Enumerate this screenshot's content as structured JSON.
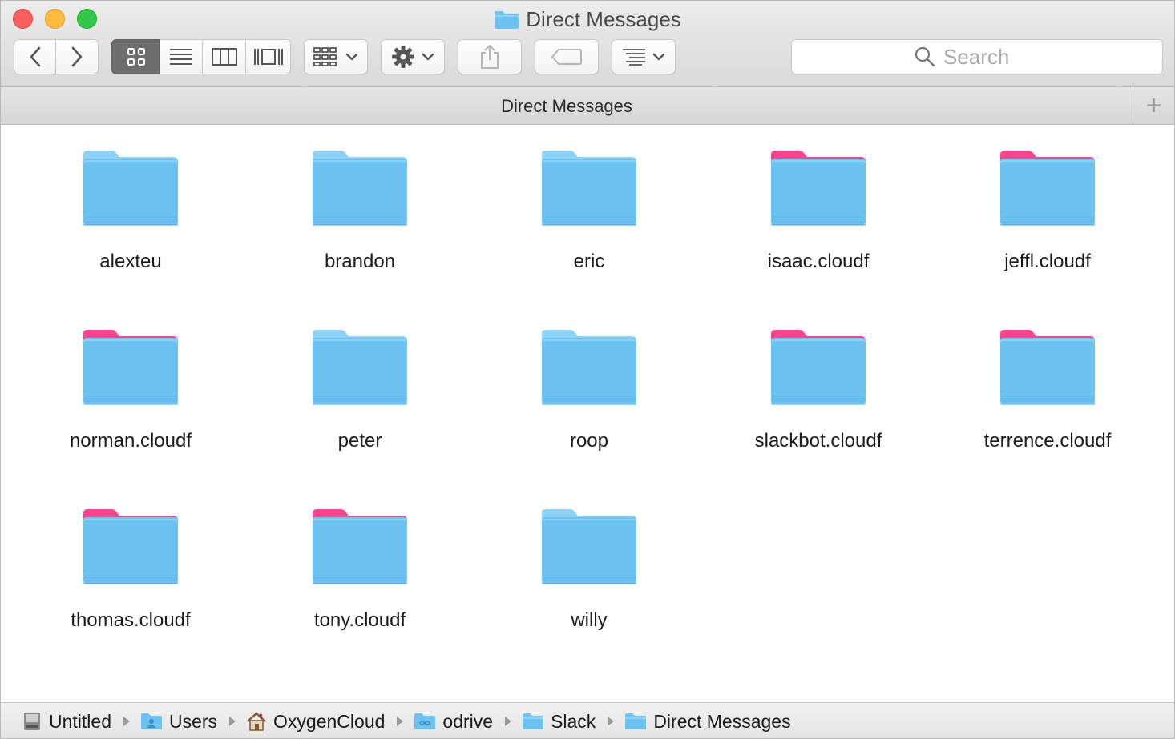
{
  "window": {
    "title": "Direct Messages"
  },
  "toolbar": {
    "back_icon": "chevron-left-icon",
    "forward_icon": "chevron-right-icon",
    "view_modes": [
      "icon-view",
      "list-view",
      "column-view",
      "coverflow-view"
    ],
    "active_view": "icon-view",
    "search_placeholder": "Search"
  },
  "pathbar_header": {
    "title": "Direct Messages",
    "add_tab_label": "+"
  },
  "colors": {
    "folder_blue": "#6cc3f2",
    "folder_blue_tab": "#8fd2f7",
    "odrive_pink": "#f7468f",
    "active_segment": "#6e6e6e"
  },
  "folders": [
    {
      "name": "alexteu",
      "synced": true
    },
    {
      "name": "brandon",
      "synced": true
    },
    {
      "name": "eric",
      "synced": true
    },
    {
      "name": "isaac.cloudf",
      "synced": false
    },
    {
      "name": "jeffl.cloudf",
      "synced": false
    },
    {
      "name": "norman.cloudf",
      "synced": false
    },
    {
      "name": "peter",
      "synced": true
    },
    {
      "name": "roop",
      "synced": true
    },
    {
      "name": "slackbot.cloudf",
      "synced": false
    },
    {
      "name": "terrence.cloudf",
      "synced": false
    },
    {
      "name": "thomas.cloudf",
      "synced": false
    },
    {
      "name": "tony.cloudf",
      "synced": false
    },
    {
      "name": "willy",
      "synced": true
    }
  ],
  "breadcrumb": [
    {
      "label": "Untitled",
      "icon": "hard-drive-icon"
    },
    {
      "label": "Users",
      "icon": "users-folder-icon"
    },
    {
      "label": "OxygenCloud",
      "icon": "home-icon"
    },
    {
      "label": "odrive",
      "icon": "odrive-folder-icon"
    },
    {
      "label": "Slack",
      "icon": "folder-icon"
    },
    {
      "label": "Direct Messages",
      "icon": "folder-icon"
    }
  ]
}
